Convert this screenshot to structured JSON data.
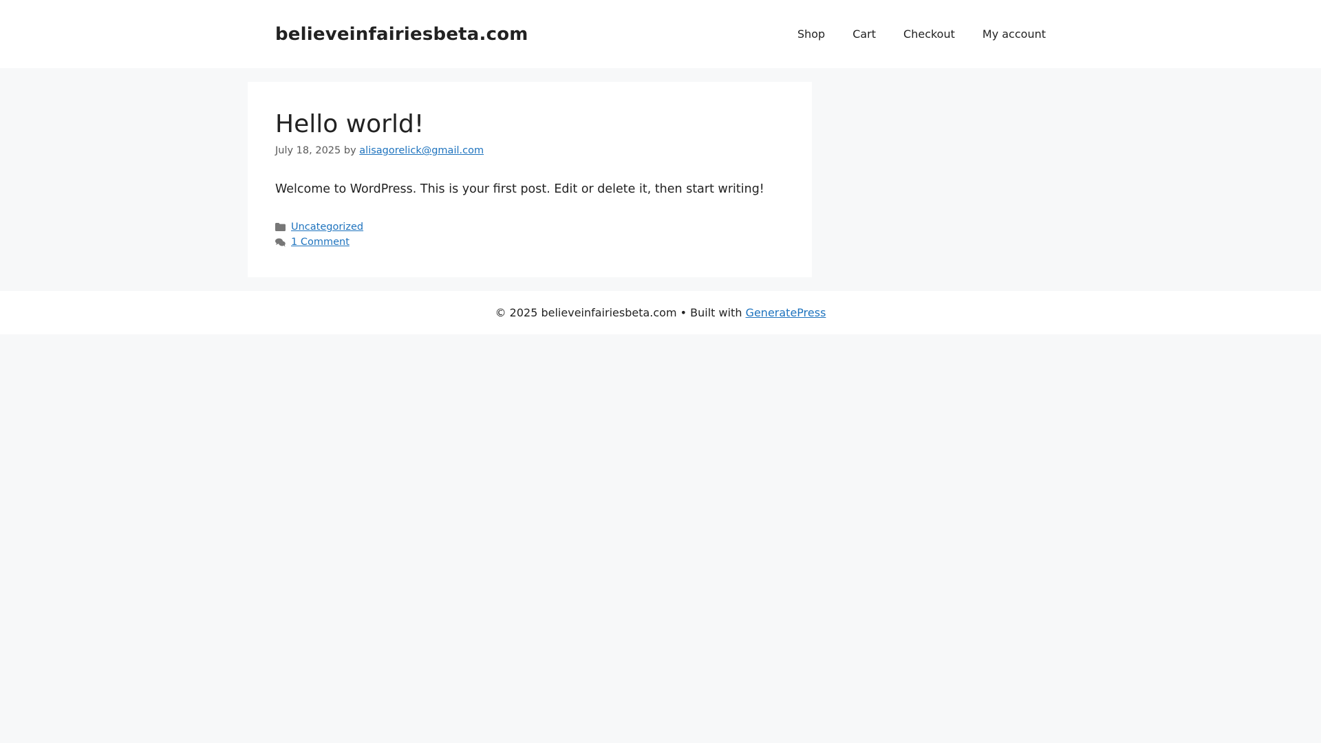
{
  "header": {
    "site_title": "believeinfairiesbeta.com",
    "nav": [
      {
        "label": "Shop"
      },
      {
        "label": "Cart"
      },
      {
        "label": "Checkout"
      },
      {
        "label": "My account"
      }
    ]
  },
  "post": {
    "title": "Hello world!",
    "date": "July 18, 2025",
    "by": "by",
    "author": "alisagorelick@gmail.com",
    "content": "Welcome to WordPress. This is your first post. Edit or delete it, then start writing!",
    "category": "Uncategorized",
    "comments": "1 Comment"
  },
  "footer": {
    "copyright": "© 2025 believeinfairiesbeta.com • Built with",
    "credit_link": "GeneratePress"
  },
  "icons": {
    "category": "folder-icon",
    "comments": "comments-icon"
  },
  "colors": {
    "link": "#1e73be",
    "background": "#f7f8f9",
    "text": "#222222"
  }
}
